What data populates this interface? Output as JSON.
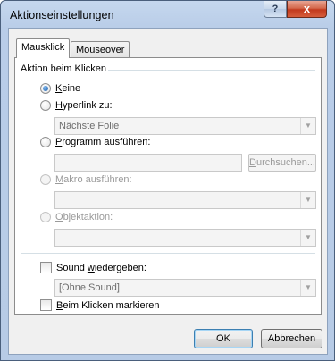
{
  "dialog": {
    "title": "Aktionseinstellungen",
    "help_glyph": "?",
    "close_glyph": "x"
  },
  "tabs": [
    {
      "label": "Mausklick",
      "active": true
    },
    {
      "label": "Mouseover",
      "active": false
    }
  ],
  "group_label": "Aktion beim Klicken",
  "options": {
    "none": {
      "acc": "K",
      "rest": "eine",
      "checked": true
    },
    "hyperlink": {
      "acc": "H",
      "rest": "yperlink zu:",
      "checked": false
    },
    "hyperlink_value": "Nächste Folie",
    "program": {
      "acc": "P",
      "rest": "rogramm ausführen:",
      "checked": false
    },
    "program_value": "",
    "browse_label_acc": "D",
    "browse_label_rest": "urchsuchen...",
    "macro": {
      "acc": "M",
      "rest": "akro ausführen:",
      "checked": false,
      "disabled": true
    },
    "macro_value": "",
    "object": {
      "acc": "O",
      "rest": "bjektaktion:",
      "checked": false,
      "disabled": true
    },
    "object_value": ""
  },
  "sound": {
    "checkbox_pre": "Sound ",
    "checkbox_acc": "w",
    "checkbox_rest": "iedergeben:",
    "checked": false,
    "value": "[Ohne Sound]"
  },
  "highlight": {
    "acc": "B",
    "rest": "eim Klicken markieren",
    "checked": false
  },
  "buttons": {
    "ok": "OK",
    "cancel": "Abbrechen"
  },
  "combo_arrow_glyph": "▼"
}
